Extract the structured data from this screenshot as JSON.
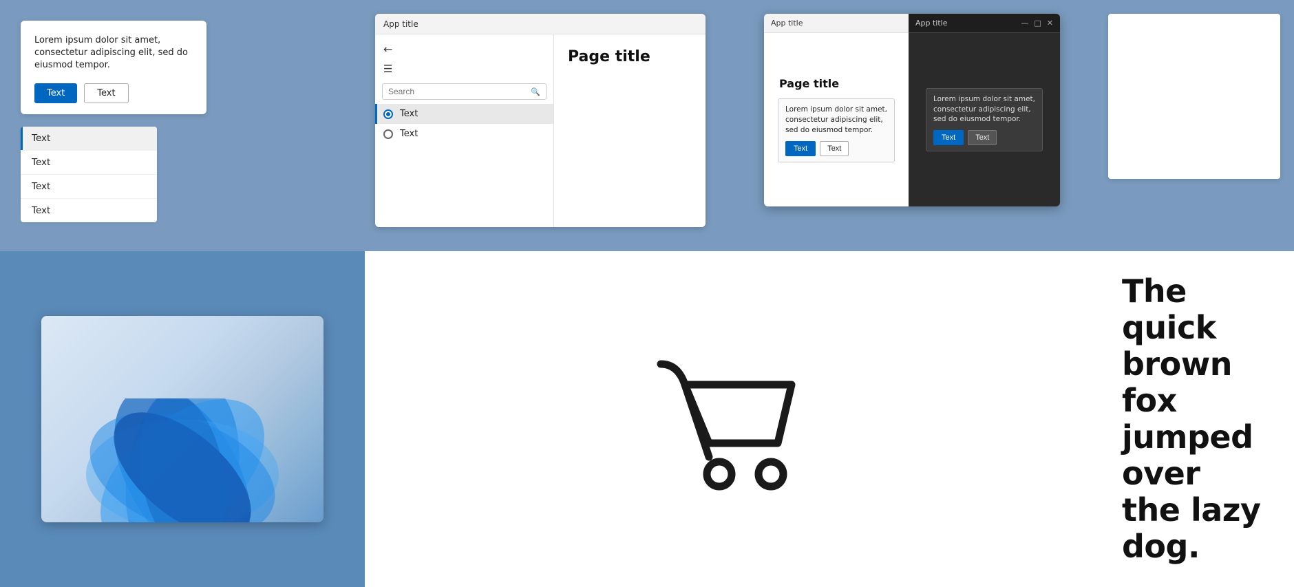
{
  "dialog": {
    "text": "Lorem ipsum dolor sit amet, consectetur adipiscing elit, sed do eiusmod tempor.",
    "btn_primary": "Text",
    "btn_secondary": "Text"
  },
  "list": {
    "items": [
      {
        "label": "Text",
        "selected": true
      },
      {
        "label": "Text",
        "selected": false
      },
      {
        "label": "Text",
        "selected": false
      },
      {
        "label": "Text",
        "selected": false
      }
    ]
  },
  "app_window": {
    "title": "App title",
    "back_icon": "←",
    "menu_icon": "☰",
    "search_placeholder": "Search",
    "nav_items": [
      {
        "label": "Text",
        "active": true
      },
      {
        "label": "Text",
        "active": false
      }
    ],
    "page_title": "Page title"
  },
  "split_dialog": {
    "title": "App title",
    "page_title": "Page title",
    "tooltip_text": "Lorem ipsum dolor sit amet, consectetur adipiscing elit, sed do eiusmod tempor.",
    "btn_primary": "Text",
    "btn_secondary": "Text",
    "win_min": "—",
    "win_max": "□",
    "win_close": "✕"
  },
  "quote": {
    "text": "The quick brown fox jumped over the lazy dog."
  }
}
